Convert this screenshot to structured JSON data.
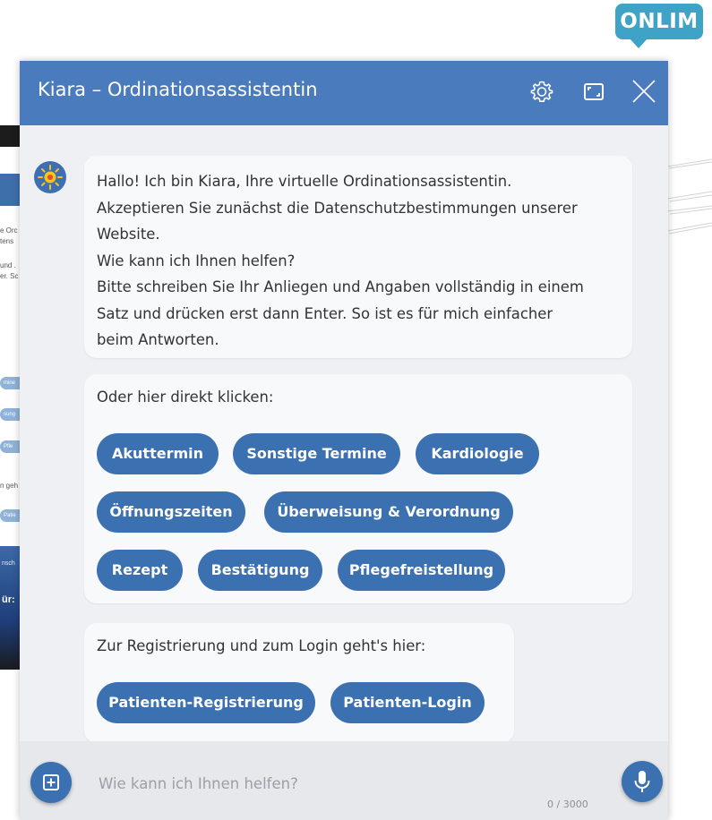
{
  "brand": {
    "badge": "ONLIM",
    "color": "#3fa3c7"
  },
  "background_page": {
    "snippets": [
      "e Orc",
      "tens",
      "und .",
      "er. Sc",
      "mine",
      "sung",
      "Pfle",
      "n geh",
      "Patie",
      "nsch",
      "ür:"
    ]
  },
  "chat": {
    "title": "Kiara – Ordinationsassistentin",
    "header_color": "#4a7bbd",
    "header_icons": [
      "gear-icon",
      "expand-icon",
      "close-icon"
    ],
    "welcome_lines": [
      "Hallo! Ich bin Kiara, Ihre virtuelle Ordinationsassistentin.",
      "Akzeptieren Sie zunächst die Datenschutzbestimmungen unserer",
      "Website.",
      "Wie kann ich Ihnen helfen?",
      "Bitte schreiben Sie Ihr Anliegen und Angaben vollständig in einem",
      "Satz und drücken erst dann Enter. So ist es für mich einfacher",
      "beim Antworten."
    ],
    "quick_replies": {
      "label": "Oder hier direkt klicken:",
      "buttons": [
        "Akuttermin",
        "Sonstige Termine",
        "Kardiologie",
        "Öffnungszeiten",
        "Überweisung & Verordnung",
        "Rezept",
        "Bestätigung",
        "Pflegefreistellung"
      ]
    },
    "registration": {
      "label": "Zur Registrierung und zum Login geht's hier:",
      "buttons": [
        "Patienten-Registrierung",
        "Patienten-Login"
      ]
    },
    "input": {
      "placeholder": "Wie kann ich Ihnen helfen?",
      "value": "",
      "counter": "0 / 3000"
    },
    "accent_color": "#3b70b1"
  }
}
